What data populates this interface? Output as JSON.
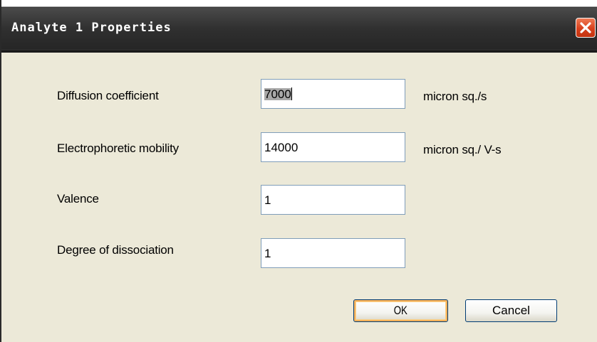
{
  "window": {
    "title": "Analyte 1 Properties"
  },
  "icons": {
    "close": "close-icon"
  },
  "colors": {
    "titlebar": "#2f2f2f",
    "close_button": "#d8401c",
    "dialog_background": "#ece9d8",
    "field_border": "#7f9db9",
    "default_button_highlight": "#f5b05a"
  },
  "form": {
    "diffusion": {
      "label": "Diffusion coefficient",
      "value": "7000",
      "unit": "micron sq./s"
    },
    "mobility": {
      "label": "Electrophoretic mobility",
      "value": "14000",
      "unit": "micron sq./ V-s"
    },
    "valence": {
      "label": "Valence",
      "value": "1"
    },
    "dissociation": {
      "label": "Degree of dissociation",
      "value": "1"
    }
  },
  "buttons": {
    "ok": "OK",
    "cancel": "Cancel"
  }
}
